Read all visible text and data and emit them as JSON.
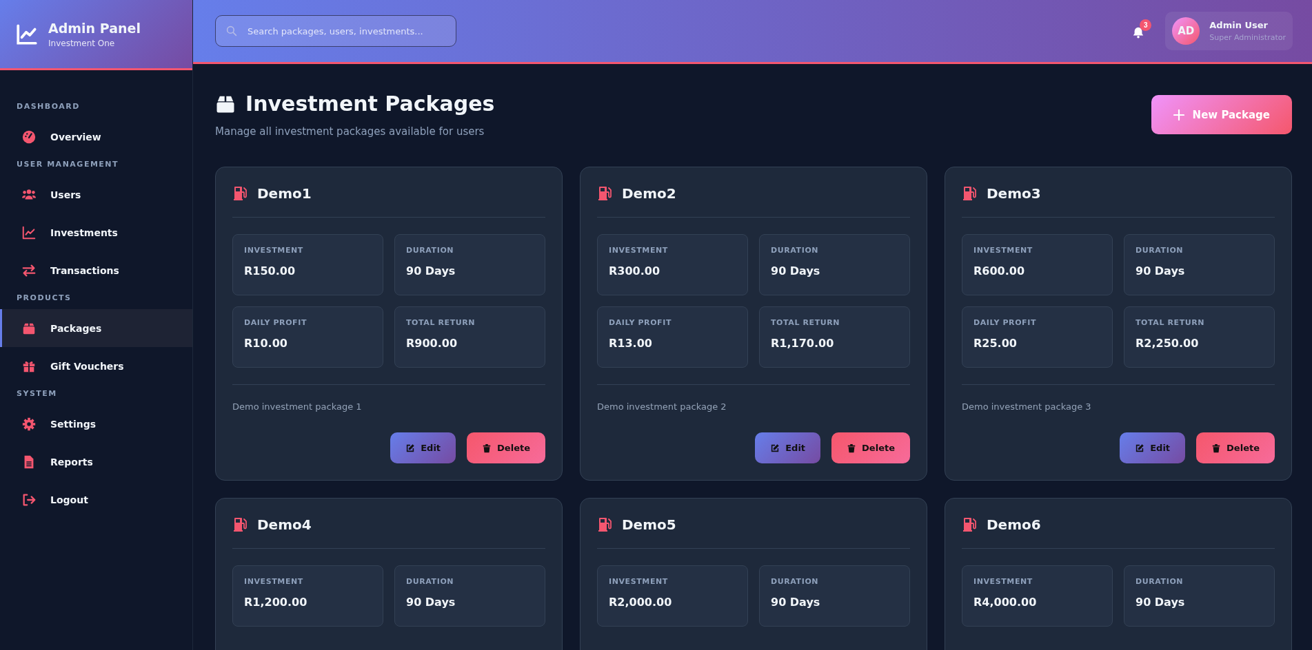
{
  "brand": {
    "title": "Admin Panel",
    "subtitle": "Investment One"
  },
  "search": {
    "placeholder": "Search packages, users, investments..."
  },
  "notifications": {
    "count": "3"
  },
  "user": {
    "initials": "AD",
    "name": "Admin User",
    "role": "Super Administrator"
  },
  "sidebar": {
    "sections": [
      {
        "title": "DASHBOARD",
        "items": [
          {
            "label": "Overview",
            "kind": "gauge",
            "selected": false
          }
        ]
      },
      {
        "title": "USER MANAGEMENT",
        "items": [
          {
            "label": "Users",
            "kind": "users",
            "selected": false
          },
          {
            "label": "Investments",
            "kind": "chart",
            "selected": false
          },
          {
            "label": "Transactions",
            "kind": "swap",
            "selected": false
          }
        ]
      },
      {
        "title": "PRODUCTS",
        "items": [
          {
            "label": "Packages",
            "kind": "box",
            "selected": true
          },
          {
            "label": "Gift Vouchers",
            "kind": "gift",
            "selected": false
          }
        ]
      },
      {
        "title": "SYSTEM",
        "items": [
          {
            "label": "Settings",
            "kind": "gear",
            "selected": false
          },
          {
            "label": "Reports",
            "kind": "file",
            "selected": false
          },
          {
            "label": "Logout",
            "kind": "logout",
            "selected": false
          }
        ]
      }
    ]
  },
  "page": {
    "title": "Investment Packages",
    "subtitle": "Manage all investment packages available for users",
    "new_button": "New Package"
  },
  "packages": [
    {
      "name": "Demo1",
      "stats": [
        {
          "label": "INVESTMENT",
          "value": "R150.00"
        },
        {
          "label": "DURATION",
          "value": "90 Days"
        },
        {
          "label": "DAILY PROFIT",
          "value": "R10.00"
        },
        {
          "label": "TOTAL RETURN",
          "value": "R900.00"
        }
      ],
      "description": "Demo investment package 1",
      "actions": [
        "Edit",
        "Delete"
      ]
    },
    {
      "name": "Demo2",
      "stats": [
        {
          "label": "INVESTMENT",
          "value": "R300.00"
        },
        {
          "label": "DURATION",
          "value": "90 Days"
        },
        {
          "label": "DAILY PROFIT",
          "value": "R13.00"
        },
        {
          "label": "TOTAL RETURN",
          "value": "R1,170.00"
        }
      ],
      "description": "Demo investment package 2",
      "actions": [
        "Edit",
        "Delete"
      ]
    },
    {
      "name": "Demo3",
      "stats": [
        {
          "label": "INVESTMENT",
          "value": "R600.00"
        },
        {
          "label": "DURATION",
          "value": "90 Days"
        },
        {
          "label": "DAILY PROFIT",
          "value": "R25.00"
        },
        {
          "label": "TOTAL RETURN",
          "value": "R2,250.00"
        }
      ],
      "description": "Demo investment package 3",
      "actions": [
        "Edit",
        "Delete"
      ]
    },
    {
      "name": "Demo4",
      "stats": [
        {
          "label": "INVESTMENT",
          "value": "R1,200.00"
        },
        {
          "label": "DURATION",
          "value": "90 Days"
        }
      ]
    },
    {
      "name": "Demo5",
      "stats": [
        {
          "label": "INVESTMENT",
          "value": "R2,000.00"
        },
        {
          "label": "DURATION",
          "value": "90 Days"
        }
      ]
    },
    {
      "name": "Demo6",
      "stats": [
        {
          "label": "INVESTMENT",
          "value": "R4,000.00"
        },
        {
          "label": "DURATION",
          "value": "90 Days"
        }
      ]
    }
  ]
}
